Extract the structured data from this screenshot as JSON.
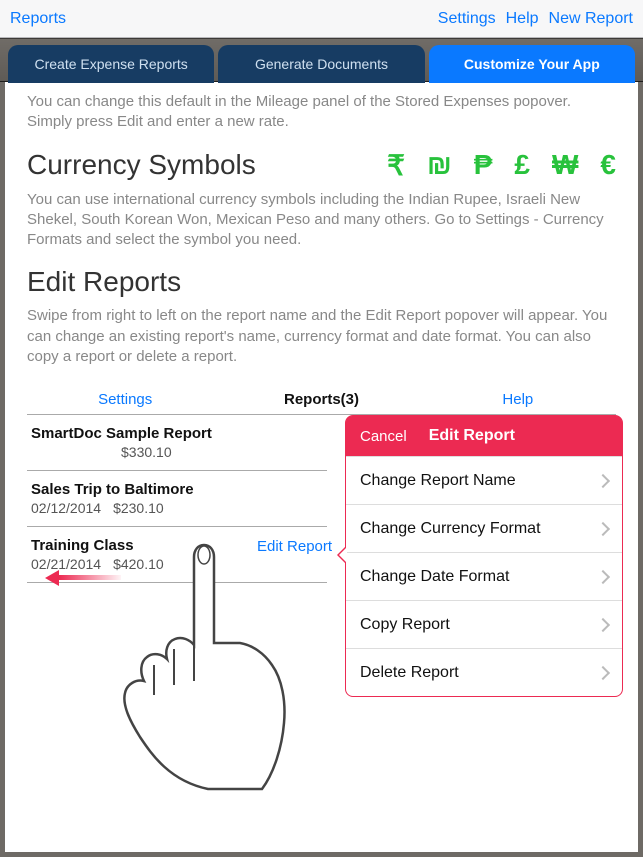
{
  "toolbar": {
    "left": "Reports",
    "settings": "Settings",
    "help": "Help",
    "newReport": "New Report"
  },
  "tabs": {
    "create": "Create Expense Reports",
    "generate": "Generate Documents",
    "customize": "Customize Your App"
  },
  "intro_para": "You can change this default in the Mileage panel of the Stored Expenses popover. Simply press Edit and enter a new rate.",
  "currency": {
    "heading": "Currency Symbols",
    "rupee": "₹",
    "shekel": "₪",
    "peso": "₱",
    "pound": "£",
    "won": "₩",
    "euro": "€",
    "para": "You can use international currency symbols including the Indian Rupee, Israeli New Shekel, South Korean Won, Mexican Peso and many others. Go to Settings - Currency Formats and select the symbol you need."
  },
  "editReports": {
    "heading": "Edit Reports",
    "para": "Swipe from right to left on the report name and the Edit Report popover will appear. You can change an existing report's name, currency format and date format. You can also copy a report or delete a report."
  },
  "example": {
    "tabs": {
      "settings": "Settings",
      "reports": "Reports(3)",
      "help": "Help"
    },
    "rows": [
      {
        "name": "SmartDoc Sample Report",
        "date": "",
        "amount": "$330.10"
      },
      {
        "name": "Sales Trip to Baltimore",
        "date": "02/12/2014",
        "amount": "$230.10"
      },
      {
        "name": "Training Class",
        "date": "02/21/2014",
        "amount": "$420.10"
      }
    ],
    "editLink": "Edit Report"
  },
  "popover": {
    "cancel": "Cancel",
    "title": "Edit Report",
    "items": [
      "Change Report Name",
      "Change Currency Format",
      "Change Date Format",
      "Copy Report",
      "Delete Report"
    ]
  }
}
